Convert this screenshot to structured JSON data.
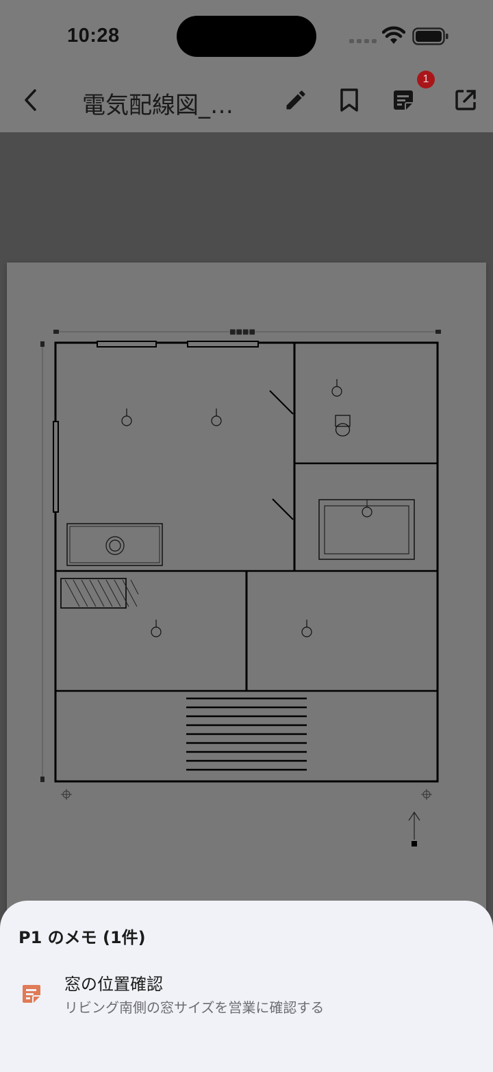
{
  "status_bar": {
    "time": "10:28"
  },
  "app_bar": {
    "title": "電気配線図_…",
    "notes_badge_count": "1",
    "icons": [
      "back-icon",
      "pencil-icon",
      "bookmark-icon",
      "note-icon",
      "open-external-icon"
    ]
  },
  "plan": {
    "dimension_text": "■■■■"
  },
  "sheet": {
    "title": "P1 のメモ (1件)",
    "memos": [
      {
        "title": "窓の位置確認",
        "description": "リビング南側の窓サイズを営業に確認する",
        "icon": "memo-icon",
        "icon_color": "#e07b57"
      }
    ]
  },
  "colors": {
    "scrim": "#7b7b7b",
    "sheet_bg": "#f1f2f7",
    "badge": "#a9161a",
    "memo_icon": "#e07b57"
  }
}
